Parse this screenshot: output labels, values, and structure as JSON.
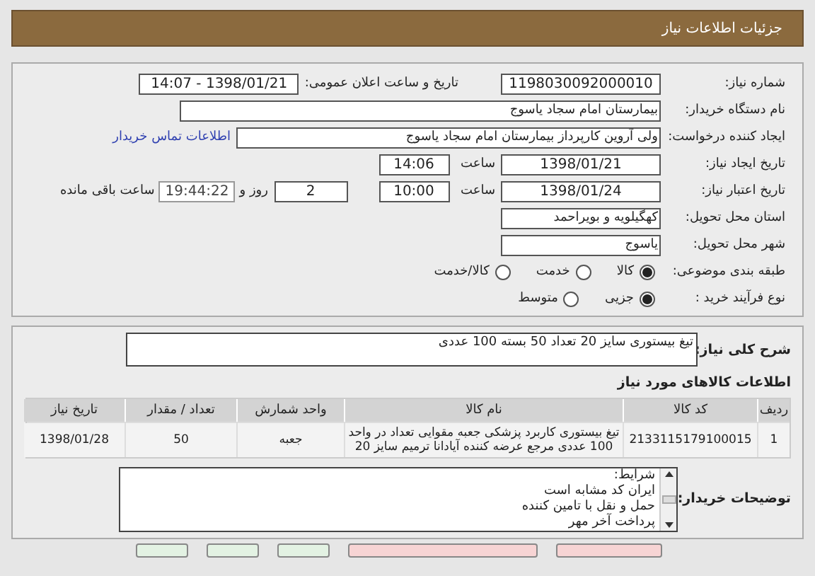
{
  "header": {
    "title": "جزئیات اطلاعات نیاز"
  },
  "need_number": {
    "label": "شماره نیاز:",
    "value": "1198030092000010"
  },
  "announce": {
    "label": "تاریخ و ساعت اعلان عمومی:",
    "value": "1398/01/21 - 14:07"
  },
  "buyer_org": {
    "label": "نام دستگاه خریدار:",
    "value": "بیمارستان امام سجاد یاسوج"
  },
  "creator": {
    "label": "ایجاد کننده درخواست:",
    "value": "ولی آروین کارپرداز بیمارستان امام سجاد یاسوج",
    "link": "اطلاعات تماس خریدار"
  },
  "created": {
    "label": "تاریخ ایجاد نیاز:",
    "date": "1398/01/21",
    "time_label": "ساعت",
    "time": "14:06"
  },
  "validity": {
    "label": "تاریخ اعتبار نیاز:",
    "date": "1398/01/24",
    "time_label": "ساعت",
    "time": "10:00",
    "days": "2",
    "days_label": "روز و",
    "remaining": "19:44:22",
    "remaining_label": "ساعت باقی مانده"
  },
  "province": {
    "label": "استان محل تحویل:",
    "value": "کهگیلویه و بویراحمد"
  },
  "city": {
    "label": "شهر محل تحویل:",
    "value": "یاسوج"
  },
  "category": {
    "label": "طبقه بندی موضوعی:",
    "options": [
      {
        "label": "کالا",
        "selected": true
      },
      {
        "label": "خدمت",
        "selected": false
      },
      {
        "label": "کالا/خدمت",
        "selected": false
      }
    ]
  },
  "process": {
    "label": "نوع فرآیند خرید :",
    "options": [
      {
        "label": "جزیی",
        "selected": true
      },
      {
        "label": "متوسط",
        "selected": false
      }
    ]
  },
  "summary": {
    "label": "شرح کلی نیاز:",
    "value": "تیغ بیستوری سایز 20 تعداد 50 بسته 100 عددی"
  },
  "goods": {
    "title": "اطلاعات کالاهای مورد نیاز",
    "columns": [
      "ردیف",
      "کد کالا",
      "نام کالا",
      "واحد شمارش",
      "تعداد / مقدار",
      "تاریخ نیاز"
    ],
    "rows": [
      [
        "1",
        "2133115179100015",
        "تیغ بیستوری کاربرد پزشکی جعبه مقوایی تعداد در واحد 100 عددی مرجع عرضه کننده آیادانا ترمیم سایز 20",
        "جعبه",
        "50",
        "1398/01/28"
      ]
    ]
  },
  "notes": {
    "label": "توضیحات خریدار:",
    "lines": [
      "شرایط:",
      "ایران کد مشابه است",
      "حمل و نقل با تامین کننده",
      "پرداخت آخر مهر"
    ]
  },
  "bottom_buttons": [
    {
      "color": "#f7d4d4"
    },
    {
      "color": "#f7d4d4"
    },
    {
      "color": "#e3f2e3"
    },
    {
      "color": "#e3f2e3"
    },
    {
      "color": "#e3f2e3"
    }
  ]
}
